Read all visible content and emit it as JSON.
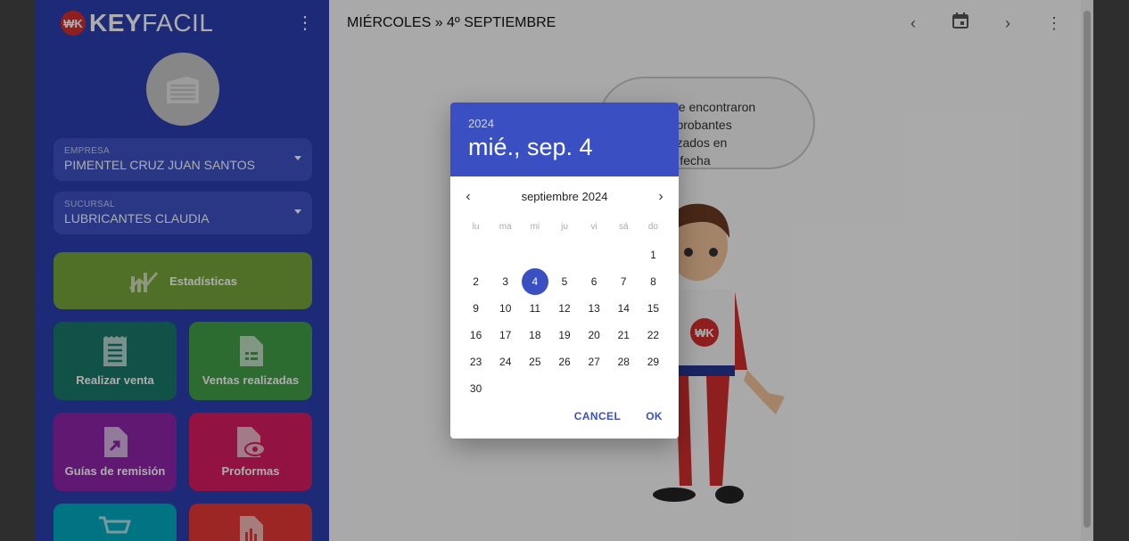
{
  "brand": {
    "badge": "₩K",
    "name_bold": "KEY",
    "name_light": "FACIL"
  },
  "sidebar": {
    "empresa": {
      "label": "EMPRESA",
      "value": "PIMENTEL CRUZ JUAN SANTOS"
    },
    "sucursal": {
      "label": "SUCURSAL",
      "value": "LUBRICANTES CLAUDIA"
    },
    "tiles": {
      "estadisticas": {
        "label": "Estadísticas",
        "color": "#76a63a",
        "icon": "stats-icon"
      },
      "realizar_venta": {
        "label": "Realizar venta",
        "color": "#1a7a6a",
        "icon": "receipt-icon"
      },
      "ventas_realizadas": {
        "label": "Ventas realizadas",
        "color": "#43a047",
        "icon": "document-icon"
      },
      "guias": {
        "label": "Guías de remisión",
        "color": "#8e24aa",
        "icon": "file-export-icon"
      },
      "proformas": {
        "label": "Proformas",
        "color": "#d81b60",
        "icon": "file-view-icon"
      },
      "tile5": {
        "color": "#00acc1",
        "icon": "cart-icon"
      },
      "tile6": {
        "color": "#e53935",
        "icon": "report-icon"
      }
    }
  },
  "topbar": {
    "title": "MIÉRCOLES » 4º SEPTIEMBRE"
  },
  "content": {
    "message_lines": [
      "No se encontraron",
      "comprobantes realizados en",
      "esta fecha"
    ]
  },
  "datepicker": {
    "year": "2024",
    "selected_label": "mié., sep. 4",
    "month_label": "septiembre 2024",
    "weekdays": [
      "lu",
      "ma",
      "mi",
      "ju",
      "vi",
      "sá",
      "do"
    ],
    "days": [
      "",
      "",
      "",
      "",
      "",
      "",
      "1",
      "2",
      "3",
      "4",
      "5",
      "6",
      "7",
      "8",
      "9",
      "10",
      "11",
      "12",
      "13",
      "14",
      "15",
      "16",
      "17",
      "18",
      "19",
      "20",
      "21",
      "22",
      "23",
      "24",
      "25",
      "26",
      "27",
      "28",
      "29",
      "30"
    ],
    "selected_day": "4",
    "cancel_label": "CANCEL",
    "ok_label": "OK",
    "accent": "#3a50c2"
  }
}
